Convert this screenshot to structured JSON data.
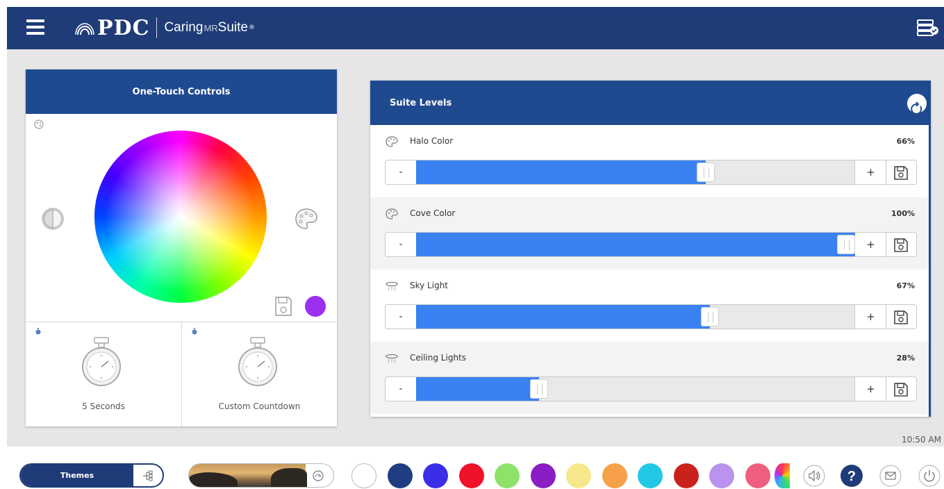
{
  "header": {
    "logo_pdc": "PDC",
    "logo_caring": "Caring",
    "logo_mr": "MR",
    "logo_suite": "Suite",
    "logo_reg": "®"
  },
  "one_touch": {
    "title": "One-Touch Controls",
    "current_color": "#9b30f0",
    "timers": [
      {
        "label": "5 Seconds"
      },
      {
        "label": "Custom Countdown"
      }
    ]
  },
  "suite_levels": {
    "title": "Suite Levels",
    "rows": [
      {
        "name": "Halo Color",
        "percent_label": "66%",
        "level": 0.66,
        "icon": "palette-icon"
      },
      {
        "name": "Cove Color",
        "percent_label": "100%",
        "level": 1.0,
        "icon": "palette-icon"
      },
      {
        "name": "Sky Light",
        "percent_label": "67%",
        "level": 0.67,
        "icon": "ceiling-light-icon"
      },
      {
        "name": "Ceiling Lights",
        "percent_label": "28%",
        "level": 0.28,
        "icon": "ceiling-light-icon"
      }
    ],
    "minus_label": "-",
    "plus_label": "+"
  },
  "time": "10:50 AM",
  "bottom": {
    "themes_label": "Themes",
    "swatches": [
      "#ffffff",
      "#1f3d80",
      "#3a2ee8",
      "#f0112a",
      "#8ee26a",
      "#8a1ec4",
      "#f6e88a",
      "#f7a04a",
      "#22c8e6",
      "#c9221c",
      "#b993ee",
      "#ef5e7e"
    ]
  },
  "colors": {
    "brand": "#1f3b78",
    "card_header": "#1f4a8f",
    "slider_fill": "#3a82f2"
  }
}
